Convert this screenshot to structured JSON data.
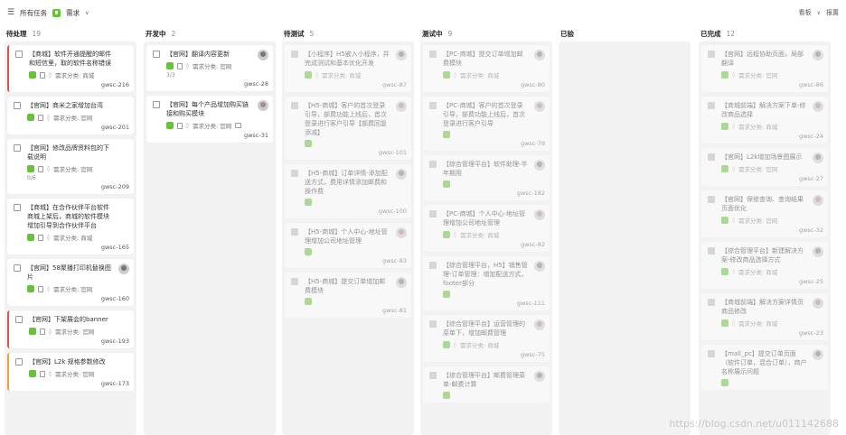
{
  "topbar": {
    "all_tasks": "所有任务",
    "type_label": "需求",
    "board_label": "看板",
    "report_label": "报置"
  },
  "columns": [
    {
      "title": "待处理",
      "count": "19",
      "cards": [
        {
          "title": "【商城】软件开通提醒的邮件和短信里，取的软件名称错误",
          "id": "gwsc-216",
          "cat": "需求分类: 商城",
          "bar": "red",
          "avatar": false
        },
        {
          "title": "【官网】商米之家增加台湾",
          "id": "gwsc-201",
          "cat": "需求分类: 官网",
          "bar": "",
          "avatar": false
        },
        {
          "title": "【官网】修改品牌资料包的下载说明",
          "id": "gwsc-209",
          "cat": "需求分类: 官网",
          "bar": "",
          "avatar": false,
          "progress": "0/6"
        },
        {
          "title": "【商城】在合作伙伴平台软件商城上架后，商城的软件模块增加引导到合作伙伴平台",
          "id": "gwsc-165",
          "cat": "需求分类: 商城",
          "bar": "",
          "avatar": false
        },
        {
          "title": "【官网】58聚播打印机替换图片",
          "id": "gwsc-160",
          "cat": "需求分类: 官网",
          "bar": "",
          "avatar": true
        },
        {
          "title": "【官网】下架展会的banner",
          "id": "gwsc-193",
          "cat": "需求分类: 官网",
          "bar": "red",
          "avatar": false
        },
        {
          "title": "【官网】L2k 规格参数修改",
          "id": "gwsc-173",
          "cat": "需求分类: 官网",
          "bar": "orange",
          "avatar": false
        }
      ]
    },
    {
      "title": "开发中",
      "count": "2",
      "cards": [
        {
          "title": "【官网】翻译内容更新",
          "id": "gwsc-28",
          "cat": "需求分类: 官网",
          "bar": "",
          "avatar": true,
          "progress": "3/3"
        },
        {
          "title": "【官网】每个产品增加购买链接和购买模块",
          "id": "gwsc-31",
          "cat": "需求分类: 官网",
          "bar": "",
          "avatar": true
        }
      ]
    },
    {
      "title": "待测试",
      "count": "5",
      "cards": [
        {
          "title": "【小程序】H5嵌入小程序，并完成测试和基本优化开发",
          "id": "gwsc-87",
          "cat": "需求分类: 商城",
          "avatar": true
        },
        {
          "title": "【H5-商城】客户的首次登录引导，部费功能上线后，首次登录进行客户引导【部费回复添减】",
          "id": "gwsc-101",
          "cat": "",
          "avatar": true
        },
        {
          "title": "【H5-商城】订单详情-添加配送方式，费用详情添加邮费和操作费",
          "id": "gwsc-100",
          "cat": "",
          "avatar": true
        },
        {
          "title": "【H5-商城】个人中心-地址管理增加公司地址管理",
          "id": "gwsc-83",
          "cat": "",
          "avatar": true
        },
        {
          "title": "【H5-商城】提交订单增加邮费模块",
          "id": "gwsc-81",
          "cat": "",
          "avatar": true
        }
      ]
    },
    {
      "title": "测试中",
      "count": "9",
      "cards": [
        {
          "title": "【PC-商城】提交订单增加邮费模块",
          "id": "gwsc-80",
          "cat": "需求分类: 商城",
          "avatar": true
        },
        {
          "title": "【PC-商城】客户的首次登录引导，部费功能上线后，首次登录进行客户引导",
          "id": "gwsc-79",
          "cat": "",
          "avatar": true
        },
        {
          "title": "【综合管理平台】软件助理-半年期用",
          "id": "gwsc-182",
          "cat": "",
          "avatar": true
        },
        {
          "title": "【PC-商城】个人中心-地址管理增加公司地址管理",
          "id": "gwsc-82",
          "cat": "需求分类: 商城",
          "avatar": true
        },
        {
          "title": "【综合管理平台，H5】销售管理-订单管理：增加配送方式，footer部分",
          "id": "gwsc-111",
          "cat": "",
          "avatar": true
        },
        {
          "title": "【综合管理平台】运营管理的菜单下，增加邮费管理",
          "id": "gwsc-75",
          "cat": "需求分类: 商城",
          "avatar": true
        },
        {
          "title": "【综合管理平台】邮费管理菜单-邮费计算",
          "id": "",
          "cat": "",
          "avatar": true
        }
      ]
    },
    {
      "title": "已验",
      "count": "",
      "cards": []
    },
    {
      "title": "已完成",
      "count": "12",
      "cards": [
        {
          "title": "【官网】远程协助页面，局部翻译",
          "id": "gwsc-86",
          "cat": "需求分类: 官网",
          "avatar": true
        },
        {
          "title": "【商城前端】解决方案下单-修改商品选择",
          "id": "gwsc-24",
          "cat": "需求分类: 商城",
          "avatar": true
        },
        {
          "title": "【官网】L2k增加场景图展示",
          "id": "gwsc-27",
          "cat": "需求分类: 官网",
          "avatar": true
        },
        {
          "title": "【官网】保修查询、查询结果页面优化",
          "id": "gwsc-32",
          "cat": "需求分类: 官网",
          "avatar": true
        },
        {
          "title": "【综合管理平台】新建解决方案-修改商品选择方式",
          "id": "gwsc-25",
          "cat": "需求分类: 商城",
          "avatar": true
        },
        {
          "title": "【商城前端】解决方案详情页商品修改",
          "id": "gwsc-23",
          "cat": "需求分类: 商城",
          "avatar": true
        },
        {
          "title": "【mall_pc】提交订单页面（软件订单，混合订单），商户名称展示问题",
          "id": "",
          "cat": "",
          "avatar": true
        }
      ]
    }
  ],
  "watermark": "https://blog.csdn.net/u011142688"
}
